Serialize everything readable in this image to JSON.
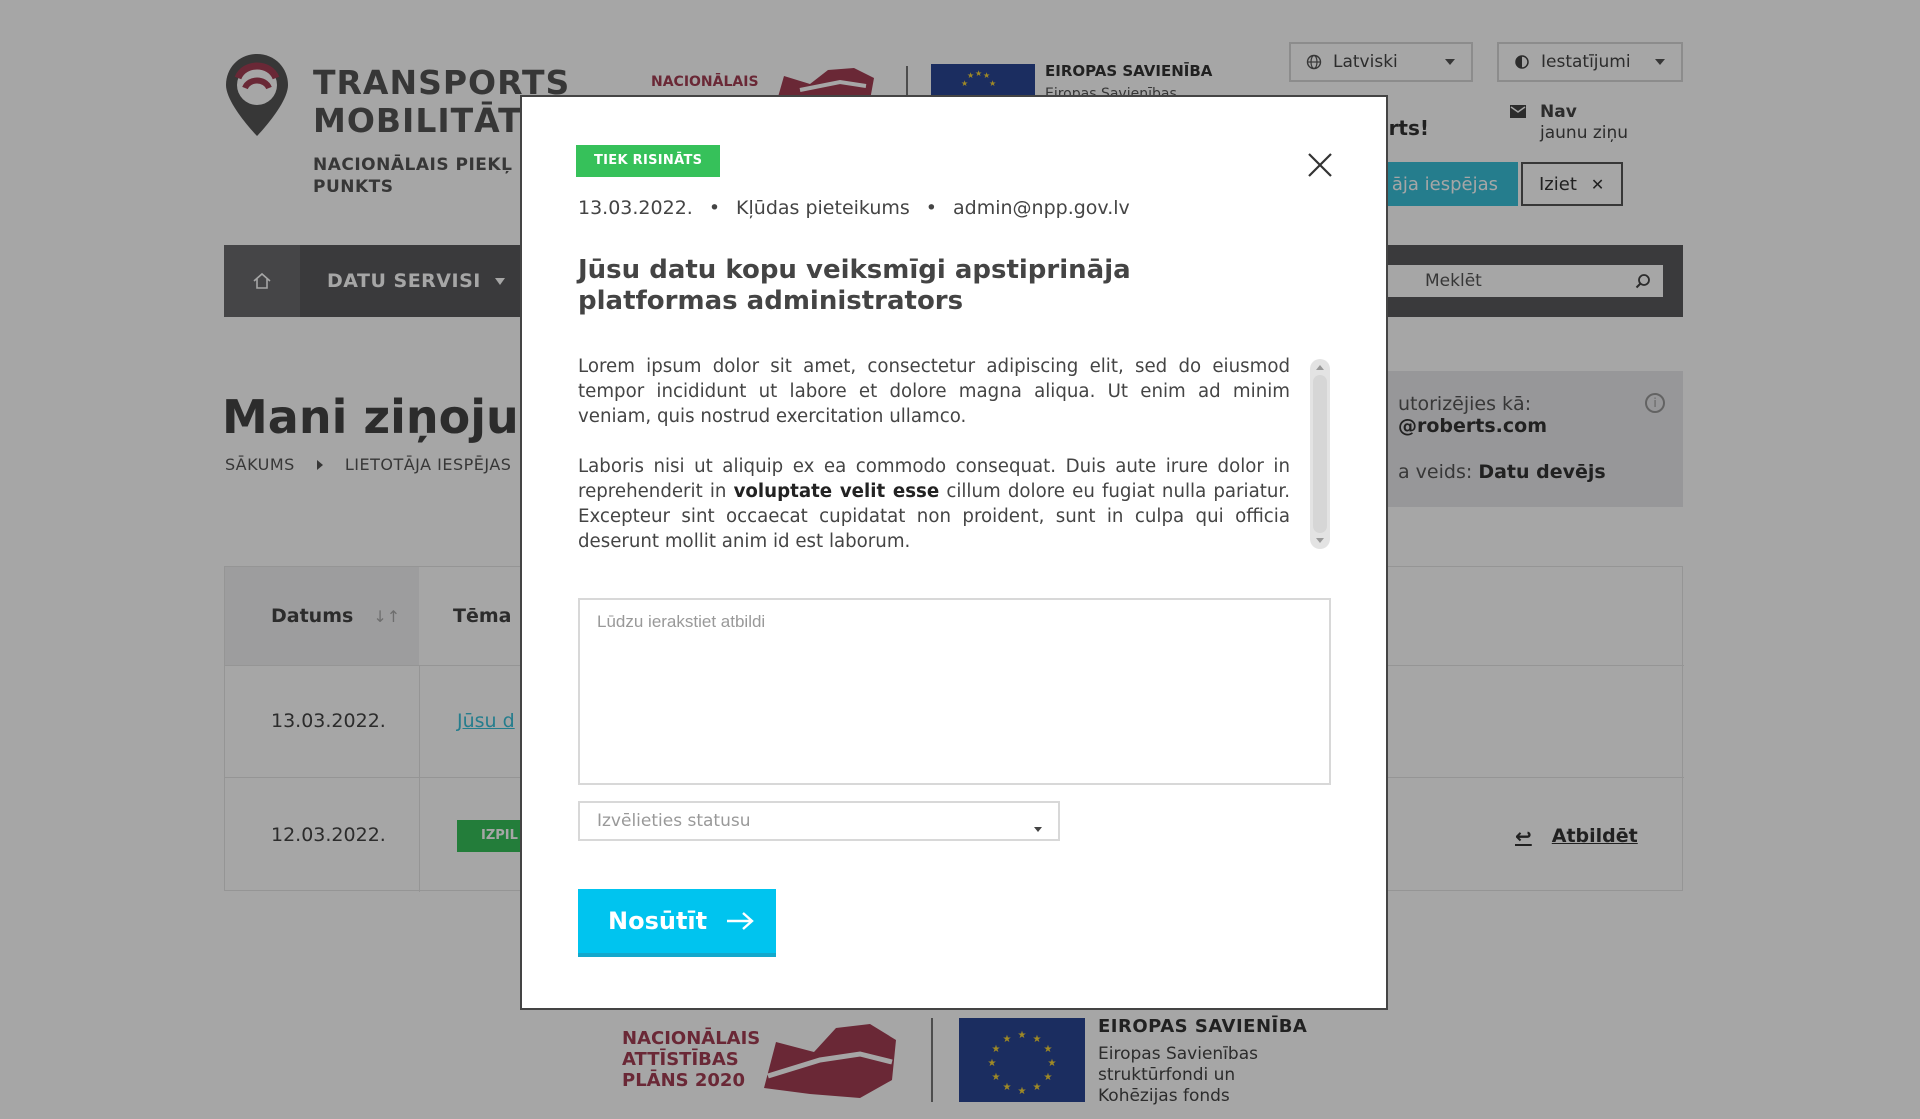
{
  "header": {
    "brand_title_line1": "TRANSPORTS",
    "brand_title_line2": "MOBILITĀTE",
    "brand_sub_line1": "NACIONĀLAIS PIEKĻ",
    "brand_sub_line2": "PUNKTS",
    "nap_top": "NACIONĀLAIS",
    "eu_top_title": "EIROPAS SAVIENĪBA",
    "eu_top_sub": "Eiropas Savienības",
    "language": "Latviski",
    "settings": "Iestatījumi",
    "welcome": "erts!",
    "mail_line1": "Nav",
    "mail_line2": "jaunu ziņu",
    "user_options": "āja iespējas",
    "logout": "Iziet"
  },
  "nav": {
    "data_services": "DATU SERVISI",
    "search_placeholder": "Meklēt"
  },
  "page": {
    "title": "Mani ziņojum",
    "breadcrumb": [
      "SĀKUMS",
      "LIETOTĀJA IESPĒJAS"
    ]
  },
  "info": {
    "line1": "utorizējies kā:",
    "line2": "@roberts.com",
    "line3_label": "a veids:",
    "line3_value": "Datu devējs"
  },
  "table": {
    "col_date": "Datums",
    "col_topic": "Tēma",
    "rows": [
      {
        "date": "13.03.2022.",
        "topic": "Jūsu d"
      },
      {
        "date": "12.03.2022.",
        "badge": "IZPIL",
        "reply": "Atbildēt"
      }
    ]
  },
  "footer": {
    "nap_line1": "NACIONĀLAIS",
    "nap_line2": "ATTĪSTĪBAS",
    "nap_line3": "PLĀNS 2020",
    "eu_title": "EIROPAS SAVIENĪBA",
    "eu_line1": "Eiropas Savienības",
    "eu_line2": "struktūrfondi un",
    "eu_line3": "Kohēzijas fonds"
  },
  "modal": {
    "status": "TIEK RISINĀTS",
    "date": "13.03.2022.",
    "type": "Kļūdas pieteikums",
    "email": "admin@npp.gov.lv",
    "title": "Jūsu datu kopu veiksmīgi apstiprināja platformas administrators",
    "para1": "Lorem ipsum dolor sit amet, consectetur adipiscing elit, sed do eiusmod tempor incididunt ut labore et dolore magna aliqua. Ut enim ad minim veniam, quis nostrud exercitation ullamco.",
    "para2_before": "Laboris nisi ut aliquip ex ea commodo consequat. Duis aute irure dolor in reprehenderit in ",
    "para2_bold": "voluptate velit esse",
    "para2_after": " cillum dolore eu fugiat nulla pariatur. Excepteur sint occaecat cupidatat non proident, sunt in culpa qui officia deserunt mollit anim id est laborum.",
    "reply_placeholder": "Lūdzu ierakstiet atbildi",
    "status_placeholder": "Izvēlieties statusu",
    "send": "Nosūtīt"
  },
  "colors": {
    "accent": "#00c4ef",
    "status_green": "#36c15a",
    "nav_bg": "#595a5c",
    "brand_red": "#a33e53",
    "eu_blue": "#2a4594"
  }
}
